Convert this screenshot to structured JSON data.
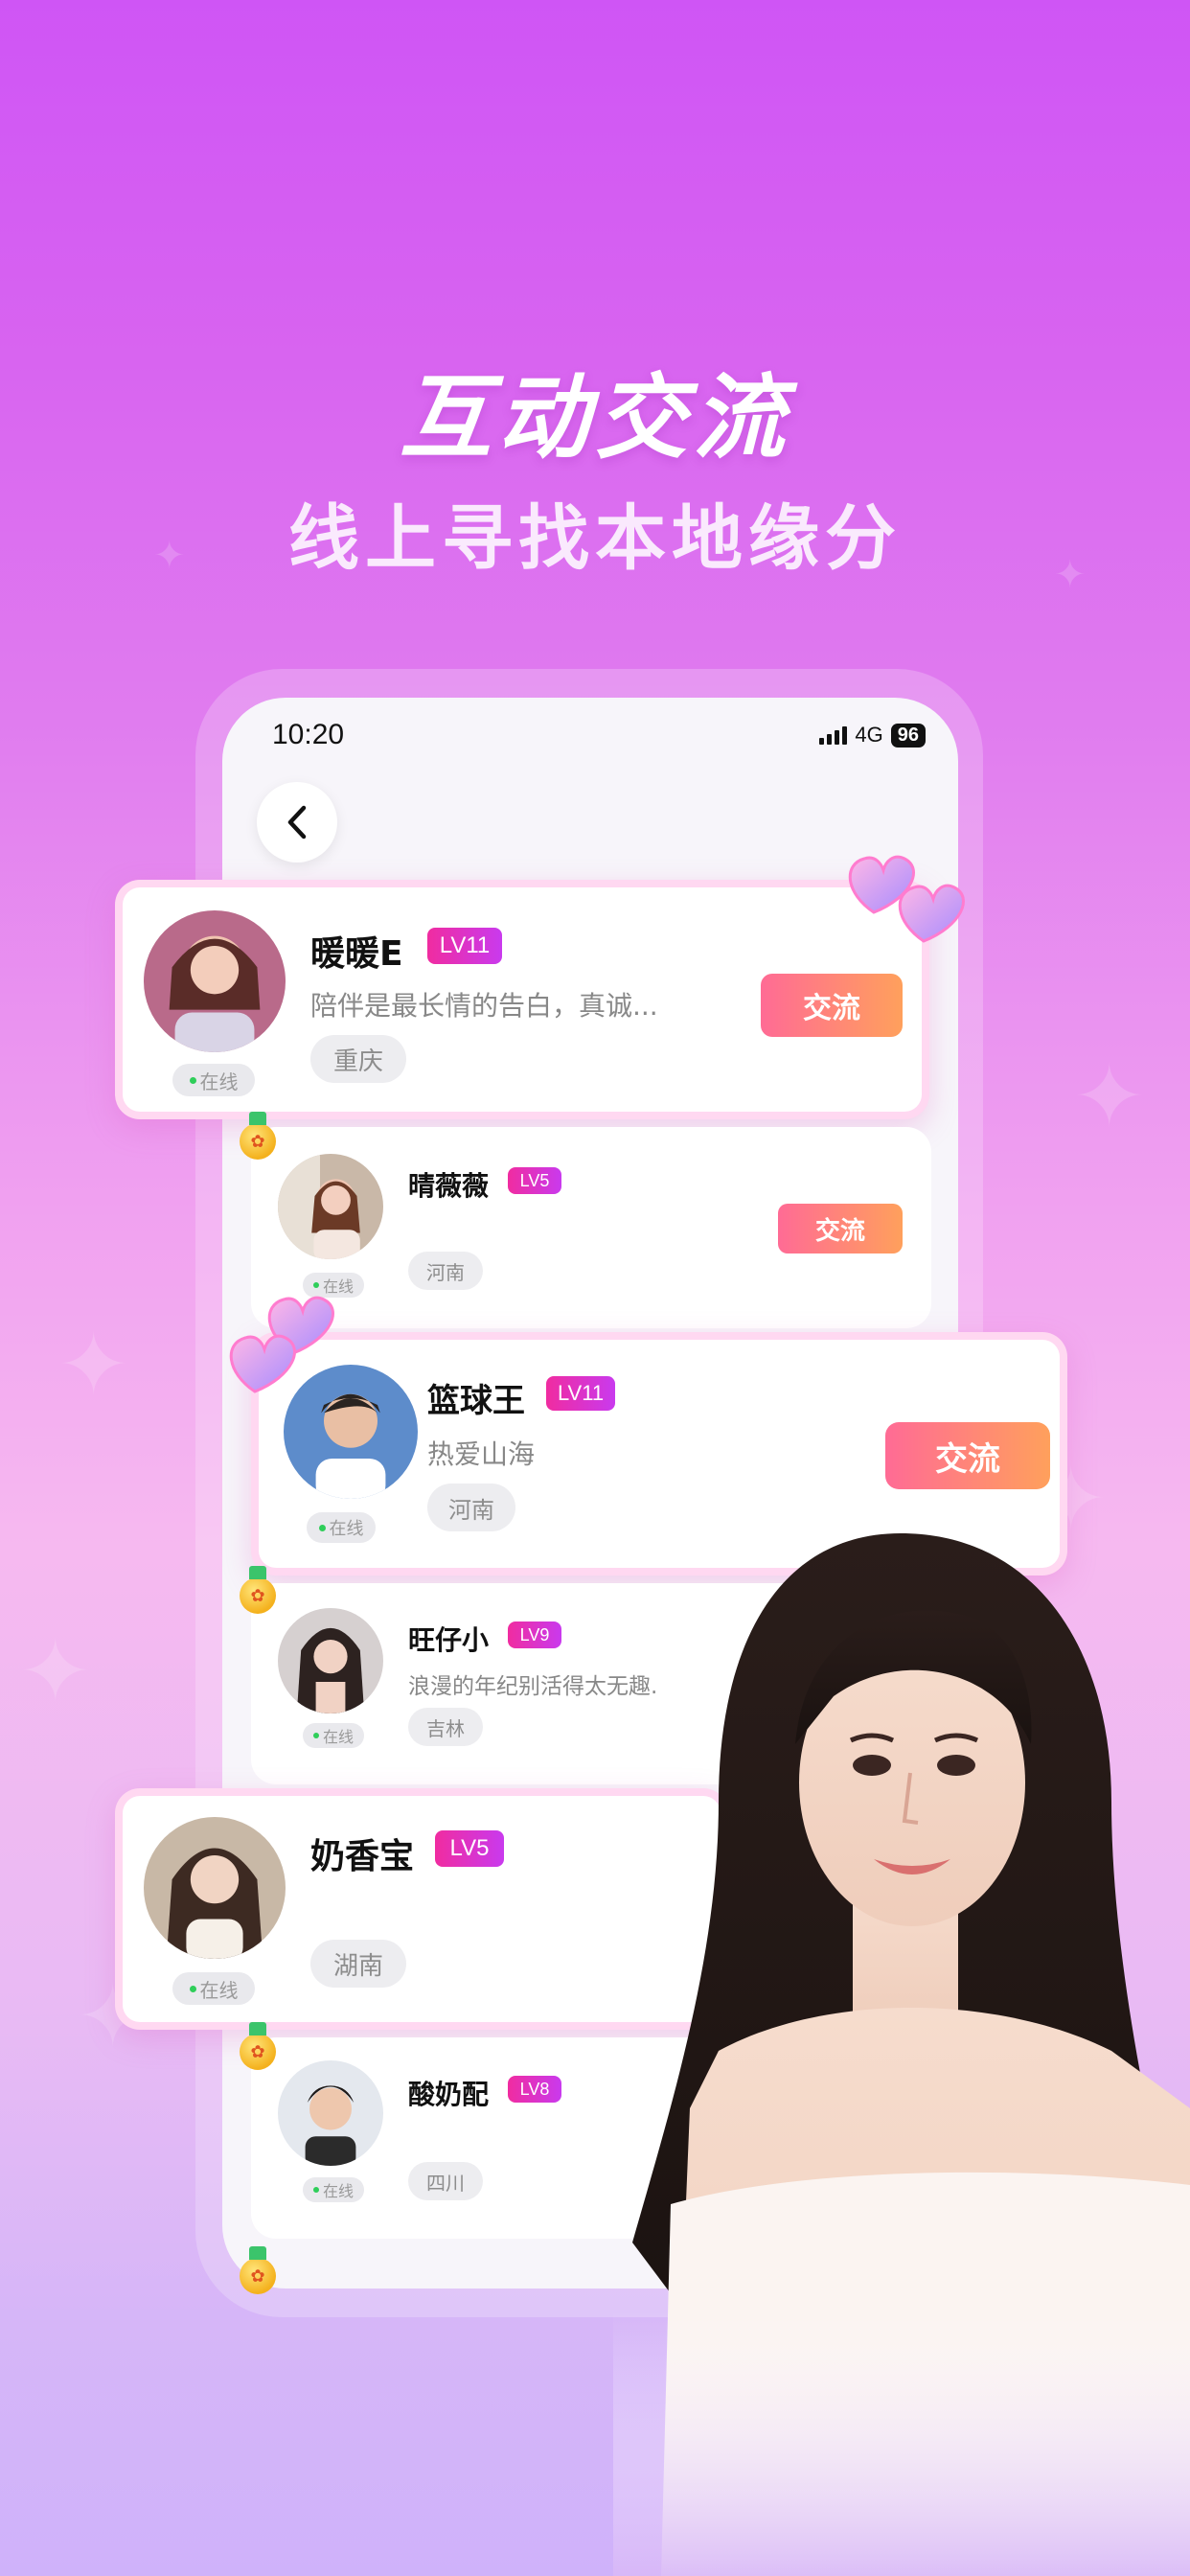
{
  "promo": {
    "title": "互动交流",
    "subtitle": "线上寻找本地缘分"
  },
  "status_bar": {
    "time": "10:20",
    "network": "4G",
    "battery": "96"
  },
  "colors": {
    "accent_gradient_start": "#ff6b95",
    "accent_gradient_end": "#ffa05c",
    "level_badge": "#f02ca0",
    "online_dot": "#2fce5a"
  },
  "users": [
    {
      "name": "暖暖E",
      "level": "LV11",
      "bio": "陪伴是最长情的告白，真诚...",
      "location": "重庆",
      "status": "在线",
      "action": "交流"
    },
    {
      "name": "晴薇薇",
      "level": "LV5",
      "bio": "",
      "location": "河南",
      "status": "在线",
      "action": "交流"
    },
    {
      "name": "篮球王",
      "level": "LV11",
      "bio": "热爱山海",
      "location": "河南",
      "status": "在线",
      "action": "交流"
    },
    {
      "name": "旺仔小",
      "level": "LV9",
      "bio": "浪漫的年纪别活得太无趣.",
      "location": "吉林",
      "status": "在线"
    },
    {
      "name": "奶香宝",
      "level": "LV5",
      "bio": "",
      "location": "湖南",
      "status": "在线"
    },
    {
      "name": "酸奶配",
      "level": "LV8",
      "bio": "",
      "location": "四川",
      "status": "在线"
    }
  ]
}
